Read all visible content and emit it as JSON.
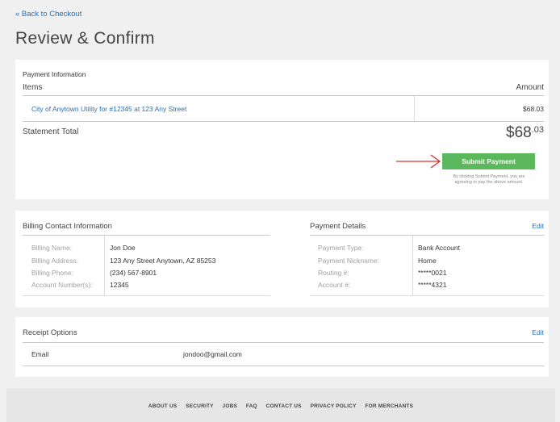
{
  "back_link": "« Back to Checkout",
  "page_title": "Review & Confirm",
  "payment_info": {
    "section_label": "Payment Information",
    "items_header": "Items",
    "amount_header": "Amount",
    "item": {
      "description": "City of Anytown Utility for #12345 at 123 Any Street",
      "amount": "$68.03"
    },
    "statement_total_label": "Statement Total",
    "statement_total_dollars": "$68",
    "statement_total_cents": ".03",
    "submit_label": "Submit Payment",
    "disclaimer": "By clicking Submit Payment, you are agreeing to pay the above amount."
  },
  "billing": {
    "title": "Billing Contact Information",
    "rows": [
      {
        "label": "Billing Name:",
        "value": "Jon Doe"
      },
      {
        "label": "Billing Address:",
        "value": "123 Any Street Anytown, AZ 85253"
      },
      {
        "label": "Billing Phone:",
        "value": "(234) 567-8901"
      },
      {
        "label": "Account Number(s):",
        "value": "12345"
      }
    ]
  },
  "payment_details": {
    "title": "Payment Details",
    "edit_label": "Edit",
    "rows": [
      {
        "label": "Payment Type:",
        "value": "Bank Account"
      },
      {
        "label": "Payment Nickname:",
        "value": "Home"
      },
      {
        "label": "Routing #:",
        "value": "*****0021"
      },
      {
        "label": "Account #:",
        "value": "*****4321"
      }
    ]
  },
  "receipt": {
    "title": "Receipt Options",
    "edit_label": "Edit",
    "method_label": "Email",
    "method_value": "jondoo@gmail.com"
  },
  "footer_links": [
    "ABOUT US",
    "SECURITY",
    "JOBS",
    "FAQ",
    "CONTACT US",
    "PRIVACY POLICY",
    "FOR MERCHANTS"
  ],
  "colors": {
    "link": "#2a6fb5",
    "submit": "#5cb85c",
    "arrow": "#d9302a"
  },
  "icons": {
    "arrow": "right-arrow-icon"
  }
}
